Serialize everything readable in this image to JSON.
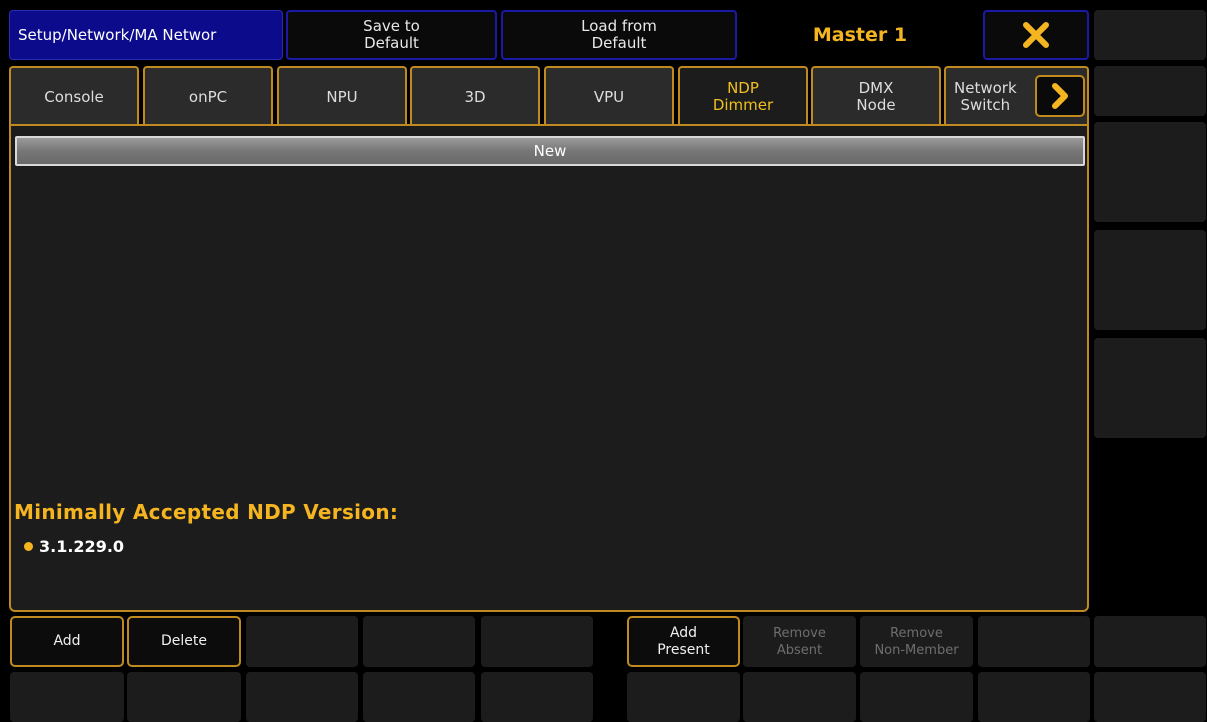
{
  "header": {
    "title": "Setup/Network/MA Networ",
    "save_to_default": "Save to\nDefault",
    "load_from_default": "Load from\nDefault",
    "master": "Master 1",
    "close_icon": "close-x-icon",
    "accent_color": "#f4b520"
  },
  "tabs": [
    {
      "label": "Console"
    },
    {
      "label": "onPC"
    },
    {
      "label": "NPU"
    },
    {
      "label": "3D"
    },
    {
      "label": "VPU"
    },
    {
      "label": "NDP\nDimmer",
      "active": true
    },
    {
      "label": "DMX\nNode"
    },
    {
      "label": "Network\nSwitch"
    }
  ],
  "tabs_next_icon": "chevron-right-icon",
  "list": {
    "new_label": "New"
  },
  "ndp": {
    "heading": "Minimally Accepted NDP Version:",
    "version": "3.1.229.0"
  },
  "bottom": {
    "add": "Add",
    "delete": "Delete",
    "add_present": "Add\nPresent",
    "remove_absent": "Remove\nAbsent",
    "remove_non_member": "Remove\nNon-Member"
  }
}
